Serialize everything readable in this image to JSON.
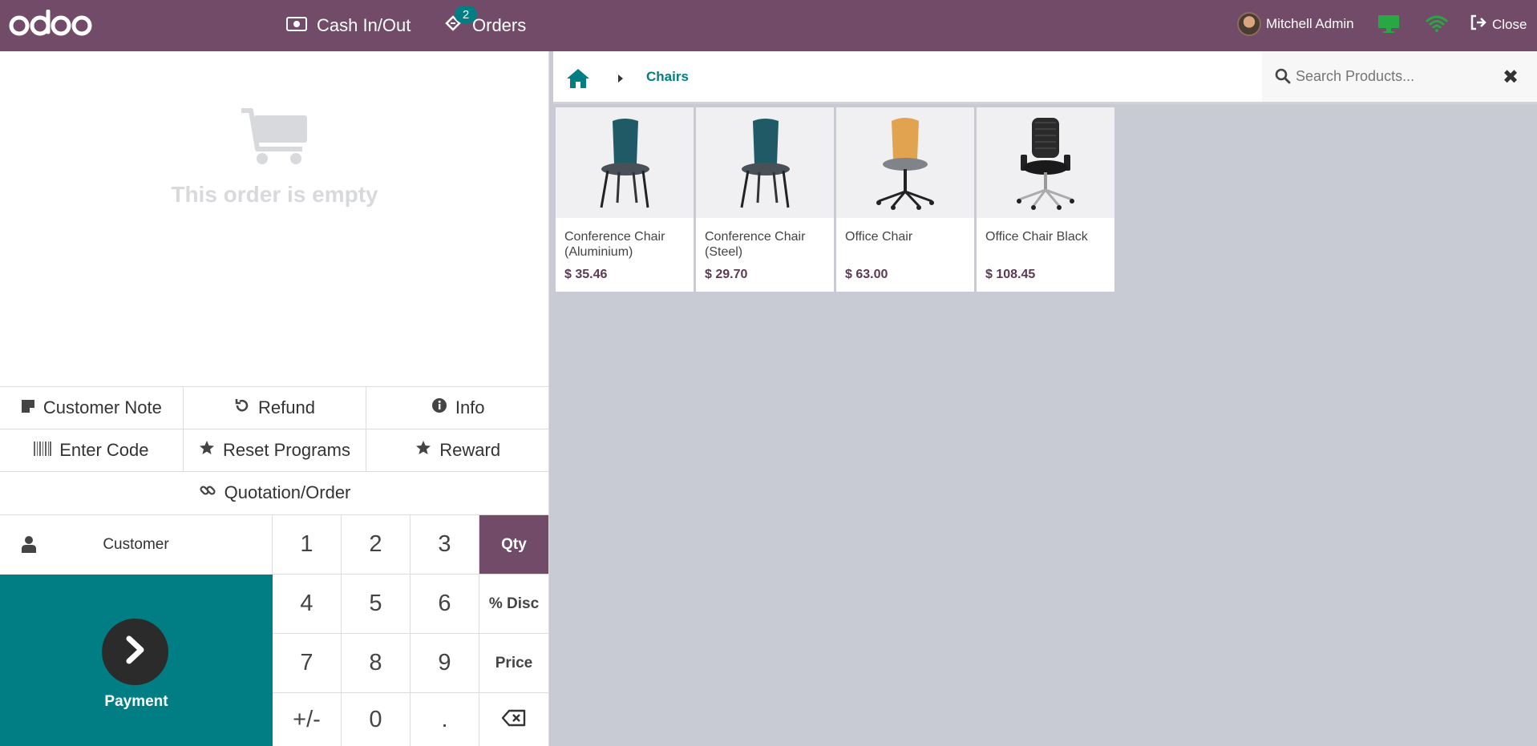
{
  "header": {
    "logo": "odoo",
    "cash_label": "Cash In/Out",
    "orders_label": "Orders",
    "orders_badge": "2",
    "user_name": "Mitchell Admin",
    "close_label": "Close"
  },
  "order": {
    "empty_text": "This order is empty"
  },
  "controls": {
    "customer_note": "Customer Note",
    "refund": "Refund",
    "info": "Info",
    "enter_code": "Enter Code",
    "reset_programs": "Reset Programs",
    "reward": "Reward",
    "quotation_order": "Quotation/Order"
  },
  "pos": {
    "customer_label": "Customer",
    "payment_label": "Payment"
  },
  "numpad": {
    "k1": "1",
    "k2": "2",
    "k3": "3",
    "qty": "Qty",
    "k4": "4",
    "k5": "5",
    "k6": "6",
    "disc": "% Disc",
    "k7": "7",
    "k8": "8",
    "k9": "9",
    "price": "Price",
    "plusminus": "+/-",
    "k0": "0",
    "dot": "."
  },
  "breadcrumb": {
    "category": "Chairs"
  },
  "search": {
    "placeholder": "Search Products..."
  },
  "products": [
    {
      "name": "Conference Chair (Aluminium)",
      "price": "$ 35.46"
    },
    {
      "name": "Conference Chair (Steel)",
      "price": "$ 29.70"
    },
    {
      "name": "Office Chair",
      "price": "$ 63.00"
    },
    {
      "name": "Office Chair Black",
      "price": "$ 108.45"
    }
  ],
  "colors": {
    "brand": "#714b67",
    "accent": "#017e84"
  }
}
